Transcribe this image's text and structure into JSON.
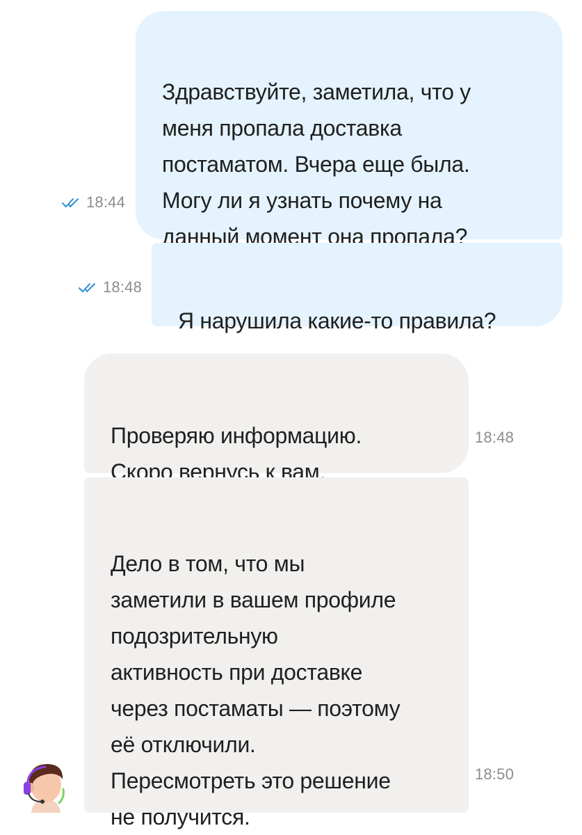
{
  "messages": [
    {
      "direction": "outgoing",
      "text": "Здравствуйте, заметила, что у\nменя пропала доставка\nпостаматом. Вчера еще была.\nМогу ли я узнать почему на\nданный момент она пропала?",
      "time": "18:44",
      "status_icon": "double-check-icon"
    },
    {
      "direction": "outgoing",
      "text": "Я нарушила какие-то правила?",
      "time": "18:48",
      "status_icon": "double-check-icon"
    },
    {
      "direction": "incoming",
      "text": "Проверяю информацию.\nСкоро вернусь к вам.",
      "time": "18:48"
    },
    {
      "direction": "incoming",
      "text": "Дело в том, что мы\nзаметили в вашем профиле\nподозрительную\nактивность при доставке\nчерез постаматы — поэтому\nеё отключили.\nПересмотреть это решение\nне получится.",
      "time": "18:50"
    }
  ],
  "support_avatar": {
    "icon": "support-agent-avatar-icon"
  },
  "colors": {
    "outgoing_bubble": "#e4f3fd",
    "incoming_bubble": "#f1f0ee",
    "read_check": "#2b8fd6",
    "timestamp": "#8c8c8c",
    "avatar_hair": "#5a2a1c",
    "avatar_headset": "#8a3fe0"
  }
}
